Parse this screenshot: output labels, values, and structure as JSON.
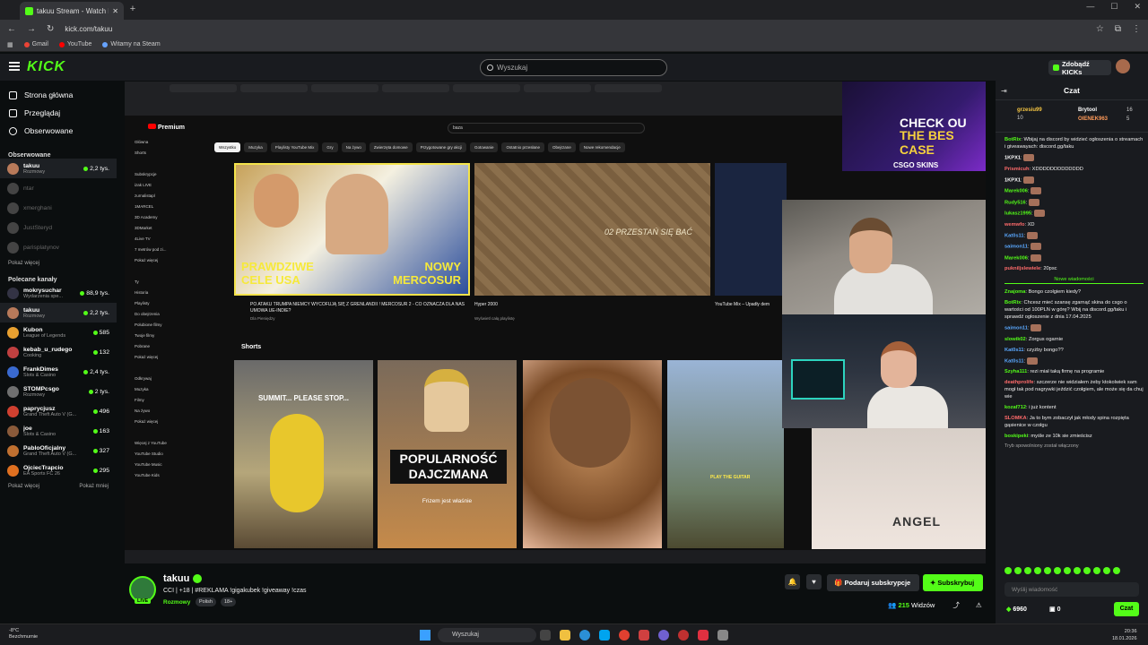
{
  "browser": {
    "tab_title": "takuu Stream - Watch Live",
    "url": "kick.com/takuu",
    "bookmarks": [
      "Gmail",
      "YouTube",
      "Witamy na Steam"
    ]
  },
  "header": {
    "search_placeholder": "Wyszukaj",
    "get_kicks": "Zdobądź KICKs"
  },
  "sidebar": {
    "nav": [
      "Strona główna",
      "Przeglądaj",
      "Obserwowane"
    ],
    "followed_title": "Obserwowane",
    "followed": [
      {
        "name": "takuu",
        "sub": "Rozmowy",
        "viewers": "2,2 tys.",
        "live": true
      },
      {
        "name": "ntar",
        "sub": "",
        "viewers": "",
        "live": false
      },
      {
        "name": "xmerghani",
        "sub": "",
        "viewers": "",
        "live": false
      },
      {
        "name": "JustSteryd",
        "sub": "",
        "viewers": "",
        "live": false
      },
      {
        "name": "parisplatynov",
        "sub": "",
        "viewers": "",
        "live": false
      }
    ],
    "show_more": "Pokaż więcej",
    "recommended_title": "Polecane kanały",
    "recommended": [
      {
        "name": "mokrysuchar",
        "sub": "Wydarzenia spe...",
        "viewers": "88,9 tys."
      },
      {
        "name": "takuu",
        "sub": "Rozmowy",
        "viewers": "2,2 tys."
      },
      {
        "name": "Kubon",
        "sub": "League of Legends",
        "viewers": "585"
      },
      {
        "name": "kebab_u_rudego",
        "sub": "Cooking",
        "viewers": "132"
      },
      {
        "name": "FrankDimes",
        "sub": "Slots & Casino",
        "viewers": "2,4 tys."
      },
      {
        "name": "STOMPcsgo",
        "sub": "Rozmowy",
        "viewers": "2 tys."
      },
      {
        "name": "paprycjusz",
        "sub": "Grand Theft Auto V (G...",
        "viewers": "496"
      },
      {
        "name": "joe",
        "sub": "Slots & Casino",
        "viewers": "163"
      },
      {
        "name": "PabloOficjalny",
        "sub": "Grand Theft Auto V (G...",
        "viewers": "327"
      },
      {
        "name": "OjciecTrapcio",
        "sub": "EA Sports FC 26",
        "viewers": "295"
      }
    ],
    "show_more2": "Pokaż więcej",
    "show_less": "Pokaż mniej"
  },
  "stream": {
    "yt_logo": "Premium",
    "yt_query": "baza",
    "chips": [
      "Wszystko",
      "Muzyka",
      "Playlisty YouTube Mix",
      "Gry",
      "Na żywo",
      "Zwierzęta domowe",
      "Przygotowane gry akcji",
      "Gotowanie",
      "Ostatnio przesłane",
      "Obejrzane",
      "Nowe rekomendacje"
    ],
    "yt_side": [
      "Główna",
      "Shorts",
      "",
      "Subskrypcje",
      "izak LIVE",
      "zurnalistapl",
      "1MARCEL",
      "3D Academy",
      "3DMarket",
      "4Live TV",
      "7 metrów pod zi...",
      "Pokaż więcej",
      "",
      "Ty",
      "Historia",
      "Playlisty",
      "Do obejrzenia",
      "Polubione filmy",
      "Twoje filmy",
      "Pobrane",
      "Pokaż więcej",
      "",
      "Odkrywaj",
      "Muzyka",
      "Filmy",
      "Na żywo",
      "Pokaż więcej",
      "",
      "Więcej z YouTube",
      "YouTube Studio",
      "YouTube Music",
      "YouTube Kids"
    ],
    "thumb1_left": "PRAWDZIWE CELE USA",
    "thumb1_right": "NOWY MERCOSUR",
    "thumb2_text": "02 PRZESTAŃ SIĘ BAĆ",
    "video1_title": "PO ATAKU TRUMPA NIEMCY WYCOFUJĄ SIĘ Z GRENLANDII ! MERCOSUR 2 - CO OZNACZA DLA NAS UMOWA UE-INDIE?",
    "video1_meta": "Dla Pieniędzy",
    "video2_title": "Hyper 2000",
    "video2_meta": "Wyświetl całą playlistę",
    "video3_title": "YouTube Mix – Upadły dem",
    "shorts_label": "Shorts",
    "short1_text": "SUMMIT... PLEASE STOP...",
    "short2_text": "POPULARNOŚĆ DAJCZMANA",
    "short2_sub": "Frizem jest właśnie",
    "short4_text": "PLAY THE GUITAR",
    "csgo_line1": "CHECK OU",
    "csgo_line2": "THE BES CASE",
    "csgo_brand": "CSGO SKINS",
    "girl_text": "ANGEL"
  },
  "channel": {
    "name": "takuu",
    "title": "CCI | +18 | #REKLAMA !gigakubek !giveaway !czas",
    "category": "Rozmowy",
    "tags": [
      "Polish",
      "18+"
    ],
    "live": "LIVE",
    "gift_label": "Podaruj subskrypcje",
    "sub_label": "Subskrybuj",
    "viewers": "215",
    "viewers_label": "Widzów"
  },
  "chat": {
    "title": "Czat",
    "pinned": [
      {
        "name": "grzesiu99",
        "value": "10"
      },
      {
        "name": "Brytool",
        "value": "16"
      },
      {
        "name": "OIENEK963",
        "value": "5"
      }
    ],
    "messages": [
      {
        "user": "BotRix",
        "color": "#53fc18",
        "text": "Wbijaj na discord by widzieć ogłoszenia o streamach i giveawayach: discord.gg/taku"
      },
      {
        "user": "1KPX1",
        "color": "#ffffff",
        "text": ""
      },
      {
        "user": "Prismicuh",
        "color": "#ff6b6b",
        "text": "XDDDDDDDDDDDDD"
      },
      {
        "user": "1KPX1",
        "color": "#ffffff",
        "text": ""
      },
      {
        "user": "Marek006",
        "color": "#53fc18",
        "text": ""
      },
      {
        "user": "Rudy516",
        "color": "#53fc18",
        "text": ""
      },
      {
        "user": "lukasz1995",
        "color": "#53fc18",
        "text": ""
      },
      {
        "user": "wemwfo",
        "color": "#ff6b6b",
        "text": "XD"
      },
      {
        "user": "Kat0s11",
        "color": "#5aa8ff",
        "text": ""
      },
      {
        "user": "saimon11",
        "color": "#5aa8ff",
        "text": ""
      },
      {
        "user": "Marek006",
        "color": "#53fc18",
        "text": ""
      },
      {
        "user": "pukniljslewiele",
        "color": "#ff6b6b",
        "text": "20psc"
      }
    ],
    "new_messages": "Nowe wiadomości",
    "messages2": [
      {
        "user": "Znajoma",
        "color": "#53fc18",
        "text": "Bongo czołgiem kiedy?"
      },
      {
        "user": "BotRix",
        "color": "#53fc18",
        "text": "Chcesz mieć szansę zgarnąć skina do csgo o wartości od 100PLN w górę? Wbij na discord.gg/taku i sprawdź ogłoszenie z dnia 17.04.2025"
      },
      {
        "user": "saimon11",
        "color": "#5aa8ff",
        "text": ""
      },
      {
        "user": "slowik02",
        "color": "#53fc18",
        "text": "Zorgus ogarnie"
      },
      {
        "user": "Kat0s11",
        "color": "#5aa8ff",
        "text": "czyżby bongo??"
      },
      {
        "user": "Kat0s11",
        "color": "#5aa8ff",
        "text": ""
      },
      {
        "user": "Szyha111",
        "color": "#53fc18",
        "text": "rezi miał taką firmę na programie"
      },
      {
        "user": "deathprolife",
        "color": "#ff6b6b",
        "text": "szczerze nie widziałem żeby ktokolwiek sam mogł tak pod nagrywki jeździć czołgiem, ale może się da chuj wie"
      },
      {
        "user": "kozaf712",
        "color": "#53fc18",
        "text": "i już kontent"
      },
      {
        "user": "SLOMKA",
        "color": "#ff6b6b",
        "text": "Ja to bym zobaczył jak młody spina rozpięta gąsienice w czołgu"
      },
      {
        "user": "boskipeki",
        "color": "#53fc18",
        "text": "myśle ze 10k sie zmieścisz"
      }
    ],
    "slow_mode": "Tryb spowolniony został włączony",
    "input_placeholder": "Wyślij wiadomość",
    "kicks_balance": "6960",
    "other_balance": "0",
    "send_label": "Czat"
  },
  "taskbar": {
    "temp": "-8°C",
    "weather": "Bezchmurnie",
    "search": "Wyszukaj",
    "time": "20:36",
    "date": "18.01.2026"
  }
}
